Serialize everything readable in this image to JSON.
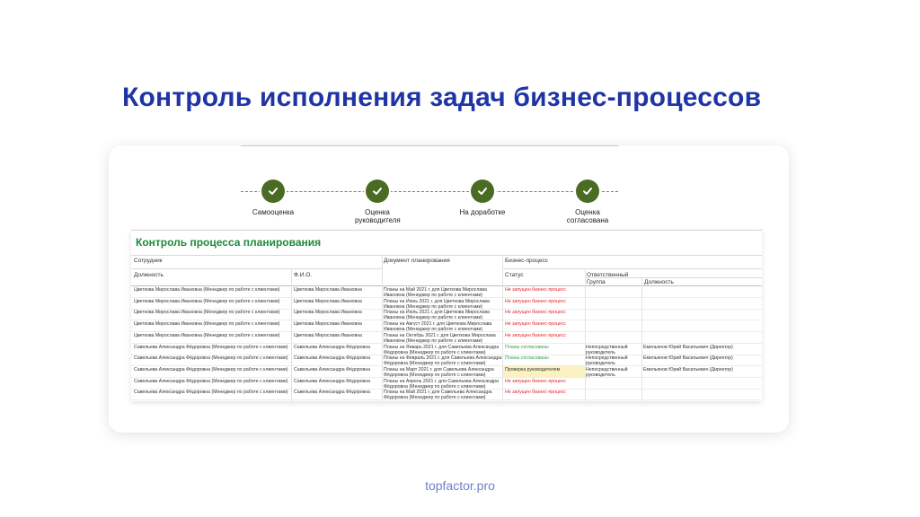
{
  "page": {
    "title": "Контроль исполнения задач бизнес-процессов",
    "footer": "topfactor.pro"
  },
  "colors": {
    "title": "#1f35a5",
    "step": "#4a6b24",
    "sheet_title": "#1f8a3b",
    "status_red": "#e0262a",
    "status_green": "#2ea043",
    "highlight": "#fbf2c2"
  },
  "steps": [
    {
      "label": "Самооценка",
      "icon": "check-icon"
    },
    {
      "label": "Оценка руководителя",
      "icon": "check-icon"
    },
    {
      "label": "На доработке",
      "icon": "check-icon"
    },
    {
      "label": "Оценка согласована",
      "icon": "check-icon"
    }
  ],
  "sheet": {
    "title": "Контроль процесса планирования",
    "headers": {
      "employee": "Сотрудник",
      "position": "Должность",
      "fio": "Ф.И.О.",
      "document": "Документ планирования",
      "bp": "Бизнес-процесс",
      "status": "Статус",
      "responsible": "Ответственный",
      "group": "Группа",
      "resp_position": "Должность"
    },
    "rows": [
      {
        "employee": "Цветкова Мирослава Ивановна (Менеджер по работе с клиентами)",
        "fio": "Цветкова Мирослава Ивановна",
        "document": "Планы на Май 2021 г. для Цветкова Мирослава Ивановна (Менеджер по работе с клиентами)",
        "status": "Не запущен бизнес-процесс",
        "status_type": "red",
        "group": "",
        "position": ""
      },
      {
        "employee": "Цветкова Мирослава Ивановна (Менеджер по работе с клиентами)",
        "fio": "Цветкова Мирослава Ивановна",
        "document": "Планы на Июнь 2021 г. для Цветкова Мирослава Ивановна (Менеджер по работе с клиентами)",
        "status": "Не запущен бизнес-процесс",
        "status_type": "red",
        "group": "",
        "position": ""
      },
      {
        "employee": "Цветкова Мирослава Ивановна (Менеджер по работе с клиентами)",
        "fio": "Цветкова Мирослава Ивановна",
        "document": "Планы на Июль 2021 г. для Цветкова Мирослава Ивановна (Менеджер по работе с клиентами)",
        "status": "Не запущен бизнес-процесс",
        "status_type": "red",
        "group": "",
        "position": ""
      },
      {
        "employee": "Цветкова Мирослава Ивановна (Менеджер по работе с клиентами)",
        "fio": "Цветкова Мирослава Ивановна",
        "document": "Планы на Август 2021 г. для Цветкова Мирослава Ивановна (Менеджер по работе с клиентами)",
        "status": "Не запущен бизнес-процесс",
        "status_type": "red",
        "group": "",
        "position": ""
      },
      {
        "employee": "Цветкова Мирослава Ивановна (Менеджер по работе с клиентами)",
        "fio": "Цветкова Мирослава Ивановна",
        "document": "Планы на Октябрь 2021 г. для Цветкова Мирослава Ивановна (Менеджер по работе с клиентами)",
        "status": "Не запущен бизнес-процесс",
        "status_type": "red",
        "group": "",
        "position": ""
      },
      {
        "employee": "Савельева Александра Фёдоровна (Менеджер по работе с клиентами)",
        "fio": "Савельева Александра Фёдоровна",
        "document": "Планы на Январь 2021 г. для Савельева Александра Фёдоровна (Менеджер по работе с клиентами)",
        "status": "Планы согласованы",
        "status_type": "green",
        "group": "Непосредственный руководитель",
        "position": "Емельянов Юрий Васильевич (Директор)"
      },
      {
        "employee": "Савельева Александра Фёдоровна (Менеджер по работе с клиентами)",
        "fio": "Савельева Александра Фёдоровна",
        "document": "Планы на Февраль 2021 г. для Савельева Александра Фёдоровна (Менеджер по работе с клиентами)",
        "status": "Планы согласованы",
        "status_type": "green",
        "group": "Непосредственный руководитель",
        "position": "Емельянов Юрий Васильевич (Директор)"
      },
      {
        "employee": "Савельева Александра Фёдоровна (Менеджер по работе с клиентами)",
        "fio": "Савельева Александра Фёдоровна",
        "document": "Планы на Март 2021 г. для Савельева Александра Фёдоровна (Менеджер по работе с клиентами)",
        "status": "Проверка руководителем",
        "status_type": "highlight",
        "group": "Непосредственный руководитель",
        "position": "Емельянов Юрий Васильевич (Директор)"
      },
      {
        "employee": "Савельева Александра Фёдоровна (Менеджер по работе с клиентами)",
        "fio": "Савельева Александра Фёдоровна",
        "document": "Планы на Апрель 2021 г. для Савельева Александра Фёдоровна (Менеджер по работе с клиентами)",
        "status": "Не запущен бизнес-процесс",
        "status_type": "red",
        "group": "",
        "position": ""
      },
      {
        "employee": "Савельева Александра Фёдоровна (Менеджер по работе с клиентами)",
        "fio": "Савельева Александра Фёдоровна",
        "document": "Планы на Май 2021 г. для Савельева Александра Фёдоровна (Менеджер по работе с клиентами)",
        "status": "Не запущен бизнес-процесс",
        "status_type": "red",
        "group": "",
        "position": ""
      }
    ]
  }
}
